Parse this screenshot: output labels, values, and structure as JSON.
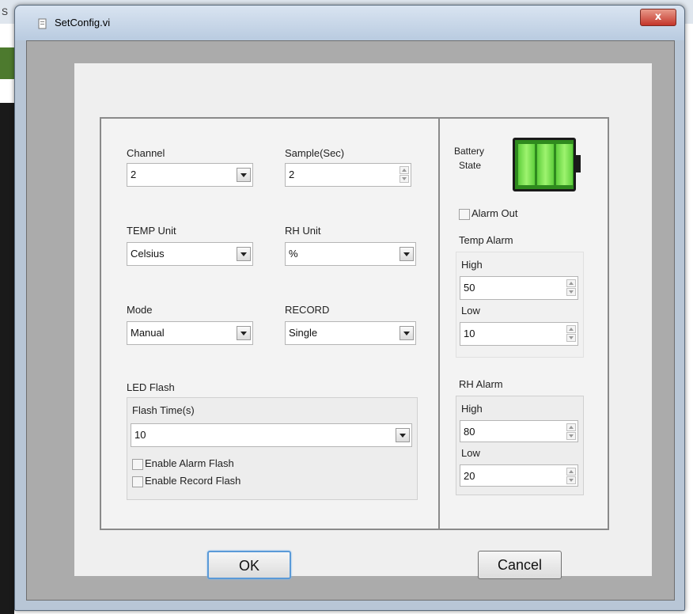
{
  "background": {
    "edge_letter": "S"
  },
  "window": {
    "title": "SetConfig.vi",
    "close_label": "x"
  },
  "left": {
    "channel": {
      "label": "Channel",
      "value": "2"
    },
    "sample": {
      "label": "Sample(Sec)",
      "value": "2"
    },
    "temp_unit": {
      "label": "TEMP Unit",
      "value": "Celsius"
    },
    "rh_unit": {
      "label": "RH Unit",
      "value": "%"
    },
    "mode": {
      "label": "Mode",
      "value": "Manual"
    },
    "record": {
      "label": "RECORD",
      "value": "Single"
    },
    "led_flash": {
      "title": "LED Flash",
      "flash_time_label": "Flash Time(s)",
      "flash_time_value": "10",
      "enable_alarm_flash": "Enable Alarm Flash",
      "enable_record_flash": "Enable Record Flash"
    }
  },
  "right": {
    "battery_label_1": "Battery",
    "battery_label_2": "State",
    "battery_level": 1.0,
    "alarm_out": "Alarm Out",
    "temp_alarm": {
      "title": "Temp Alarm",
      "high_label": "High",
      "high_value": "50",
      "low_label": "Low",
      "low_value": "10"
    },
    "rh_alarm": {
      "title": "RH Alarm",
      "high_label": "High",
      "high_value": "80",
      "low_label": "Low",
      "low_value": "20"
    }
  },
  "buttons": {
    "ok": "OK",
    "cancel": "Cancel"
  },
  "colors": {
    "battery_green": "#5fcf3c",
    "ok_focus": "#5a9ad8"
  }
}
